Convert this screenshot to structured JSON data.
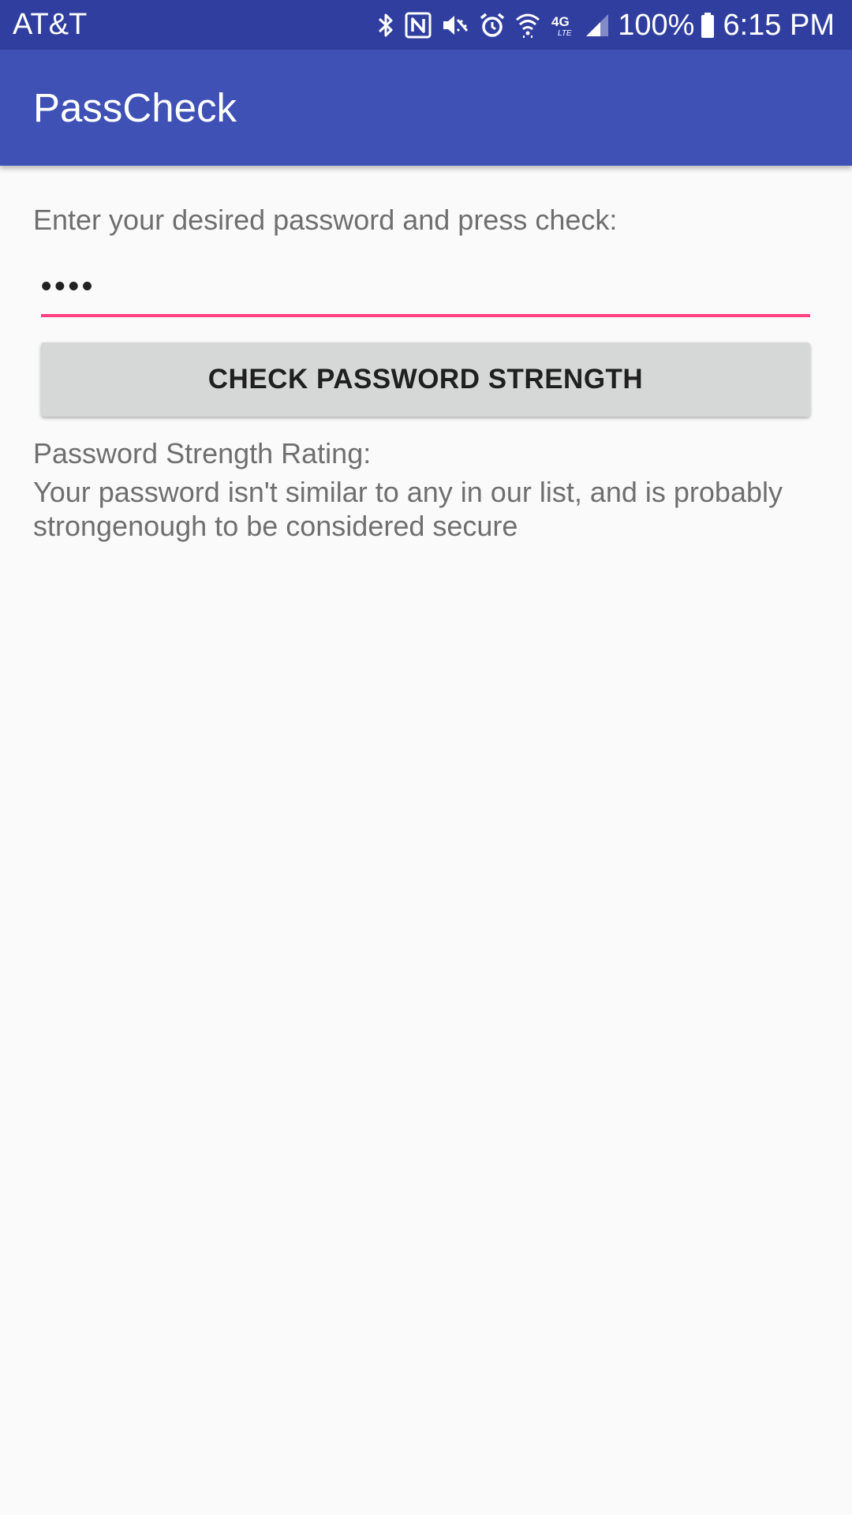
{
  "status_bar": {
    "carrier": "AT&T",
    "battery": "100%",
    "time": "6:15 PM",
    "icons": [
      "bluetooth-icon",
      "nfc-icon",
      "vibrate-mute-icon",
      "alarm-icon",
      "wifi-icon",
      "lte-icon",
      "signal-icon",
      "battery-icon"
    ]
  },
  "app_bar": {
    "title": "PassCheck"
  },
  "main": {
    "prompt": "Enter your desired password and press check:",
    "password_value": "••••",
    "check_button_label": "CHECK PASSWORD STRENGTH",
    "rating_label": "Password Strength Rating:",
    "rating_result": "Your password isn't similar to any in our list, and is probably strongenough to be considered secure"
  },
  "colors": {
    "status_bar": "#303f9f",
    "app_bar": "#3f51b5",
    "accent": "#ff4081",
    "background": "#fafafa",
    "button": "#d6d7d7"
  }
}
